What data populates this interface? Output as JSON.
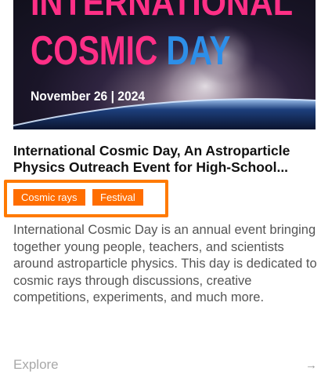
{
  "hero": {
    "line1": "INTERNATIONAL",
    "line2_part1": "COSMIC ",
    "line2_part2": "DAY",
    "date": "November 26 | 2024"
  },
  "card": {
    "title": "International Cosmic Day, An Astroparticle Physics Outreach Event for High-School...",
    "tags": [
      "Cosmic rays",
      "Festival"
    ],
    "description": "International Cosmic Day is an annual event bringing together young people, teachers, and scientists around astroparticle physics. This day is dedicated to cosmic rays through discussions, creative competitions, experiments, and much more.",
    "explore_label": "Explore",
    "explore_arrow": "→"
  },
  "colors": {
    "tag_bg": "#ff6d00",
    "highlight_border": "#ff7a00",
    "title_pink": "#ff2f86",
    "title_blue": "#2d8fe9"
  }
}
